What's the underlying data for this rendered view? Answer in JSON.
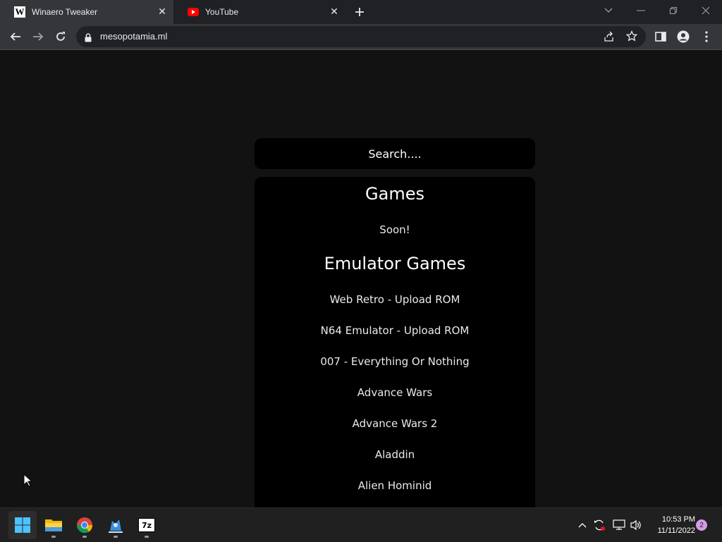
{
  "browser": {
    "tabs": [
      {
        "title": "Winaero Tweaker",
        "favicon": "winaero-w-icon",
        "favicon_text": "W",
        "active": true
      },
      {
        "title": "YouTube",
        "favicon": "youtube-icon",
        "active": false
      }
    ],
    "url": "mesopotamia.ml"
  },
  "page": {
    "search_placeholder": "Search....",
    "sections": [
      {
        "title": "Games",
        "items": [
          "Soon!"
        ]
      },
      {
        "title": "Emulator Games",
        "items": [
          "Web Retro - Upload ROM",
          "N64 Emulator - Upload ROM",
          "007 - Everything Or Nothing",
          "Advance Wars",
          "Advance Wars 2",
          "Aladdin",
          "Alien Hominid"
        ]
      }
    ]
  },
  "taskbar": {
    "apps": [
      "windows-start-icon",
      "file-explorer-icon",
      "chrome-icon",
      "app-icon",
      "7zip-icon"
    ],
    "seven_zip_label": "7z",
    "time": "10:53 PM",
    "date": "11/11/2022",
    "notification_count": "2"
  },
  "colors": {
    "page_bg": "#121212",
    "panel_bg": "#000000",
    "chrome_tab_bg": "#202124",
    "chrome_toolbar_bg": "#35363a"
  }
}
